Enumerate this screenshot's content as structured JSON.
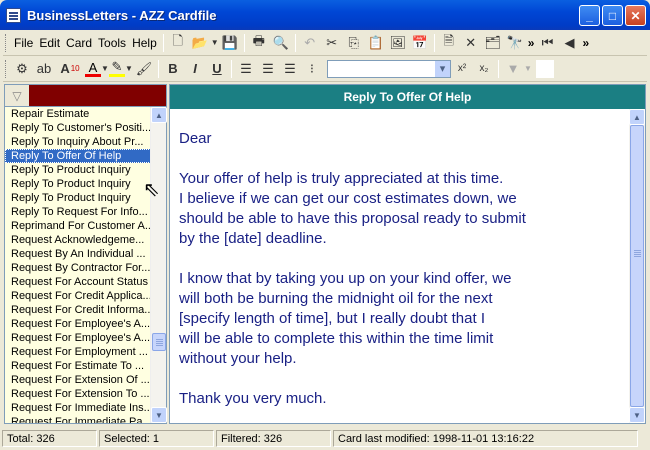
{
  "window": {
    "title": "BusinessLetters - AZZ Cardfile"
  },
  "menu": {
    "items": [
      "File",
      "Edit",
      "Card",
      "Tools",
      "Help"
    ]
  },
  "format": {
    "font_size": "10"
  },
  "cards": {
    "items": [
      "Repair Estimate",
      "Reply To Customer's Positi...",
      "Reply To Inquiry About Pr...",
      "Reply To Offer Of Help",
      "Reply To Product Inquiry",
      "Reply To Product Inquiry",
      "Reply To Product Inquiry",
      "Reply To Request For Info...",
      "Reprimand For Customer A...",
      "Request Acknowledgeme...",
      "Request By An Individual ...",
      "Request By Contractor For...",
      "Request For Account Status",
      "Request For Credit Applica...",
      "Request For Credit Informa...",
      "Request For Employee's A...",
      "Request For Employee's A...",
      "Request For Employment ...",
      "Request For Estimate To ...",
      "Request For Extension Of ...",
      "Request For Extension To ...",
      "Request For Immediate Ins...",
      "Request For Immediate Pa..."
    ],
    "selected_index": 3
  },
  "card": {
    "title": "Reply To Offer Of Help",
    "body": [
      "Dear",
      "Your offer of help is truly appreciated at this time.\nI believe if we can get our cost estimates down, we\nshould be able to have this proposal ready to submit\nby the [date] deadline.",
      "I know that by taking you up on your kind offer, we\nwill both be burning the midnight oil for the next\n[specify length of time], but I really doubt that I\nwill be able to complete this within the time limit\nwithout your help.",
      "Thank you very much."
    ]
  },
  "status": {
    "total": "Total: 326",
    "selected": "Selected: 1",
    "filtered": "Filtered: 326",
    "modified": "Card last modified: 1998-11-01  13:16:22"
  },
  "colors": {
    "title_bar": "#0046d5",
    "card_header": "#1b7f83",
    "filter_field": "#800000",
    "list_bg": "#ffffe1",
    "text": "#1a2185"
  }
}
